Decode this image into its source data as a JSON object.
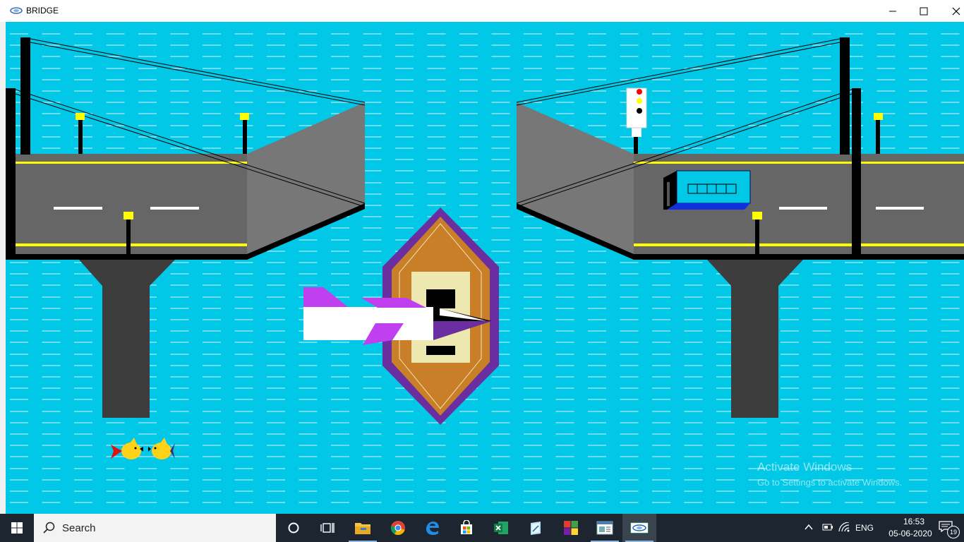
{
  "window": {
    "title": "BRIDGE",
    "controls": [
      "minimize",
      "maximize",
      "close"
    ]
  },
  "scene": {
    "water_color": "#00c8e6",
    "road_color": "#666666",
    "pillar_color": "#3d3d3d",
    "lane_line_color": "#ffff00",
    "lamp_color": "#ffff00",
    "boat_hull_color": "#c87f28",
    "boat_rim_color": "#6a2ea0",
    "plane_fin_color": "#c040f0",
    "bus_color": "#00c8e6",
    "traffic_light": [
      "red",
      "yellow",
      "black"
    ]
  },
  "watermark": {
    "title": "Activate Windows",
    "subtitle": "Go to Settings to activate Windows."
  },
  "taskbar": {
    "search_placeholder": "Search",
    "apps": [
      "task-view",
      "file-explorer",
      "chrome",
      "edge",
      "store",
      "excel",
      "notepad",
      "office",
      "editor",
      "bridge-app"
    ],
    "language": "ENG",
    "time": "16:53",
    "date": "05-06-2020",
    "notification_count": "19"
  }
}
